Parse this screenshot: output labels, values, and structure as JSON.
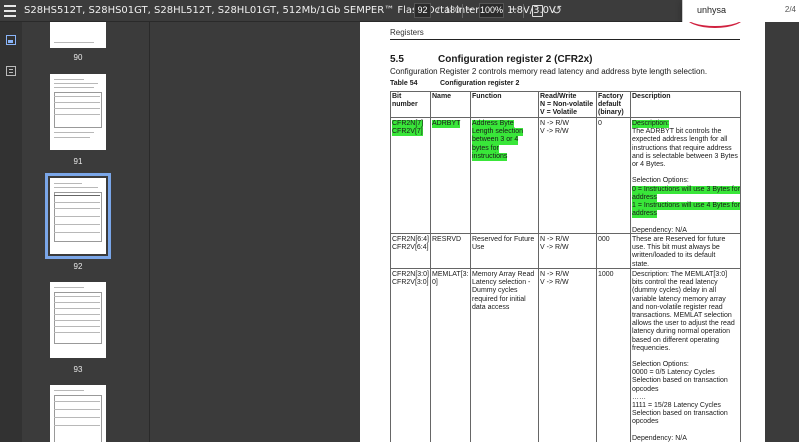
{
  "toolbar": {
    "title": "S28HS512T, S28HS01GT, S28HL512T, S28HL01GT, 512Mb/1Gb SEMPER™ Flash Octal interface, 1.8V/3.0V",
    "page_current": "92",
    "page_sep": "/",
    "page_total": "180",
    "zoom_out_symbol": "–",
    "zoom_value": "100%",
    "zoom_in_symbol": "+"
  },
  "search": {
    "value": "unhysa",
    "count": "2/4"
  },
  "sidebar": {
    "thumbnails": [
      {
        "label": "90"
      },
      {
        "label": "91"
      },
      {
        "label": "92",
        "selected": true
      },
      {
        "label": "93"
      }
    ]
  },
  "page": {
    "header": "Registers",
    "section_number": "5.5",
    "section_title": "Configuration register 2 (CFR2x)",
    "section_desc": "Configuration Register 2 controls memory read latency and address byte length selection.",
    "table_number": "Table 54",
    "table_title": "Configuration register 2",
    "columns": [
      [
        "Bit",
        "number"
      ],
      [
        "Name"
      ],
      [
        "Function"
      ],
      [
        "Read/Write",
        "N = Non-volatile",
        "V = Volatile"
      ],
      [
        "Factory",
        "default",
        "(binary)"
      ],
      [
        "Description"
      ]
    ],
    "rows": [
      {
        "bit": [
          "CFR2N[7]",
          "CFR2V[7]"
        ],
        "name": [
          "ADRBYT"
        ],
        "function": [
          "Address Byte",
          "Length selection",
          "between 3 or 4",
          "bytes for",
          "instructions"
        ],
        "rw": [
          "N -> R/W",
          "V -> R/W"
        ],
        "default": [
          "0"
        ],
        "description": [
          "Description:",
          "The ADRBYT bit controls the",
          "expected address length for all",
          "instructions that require address",
          "and is selectable between 3 Bytes",
          "or 4 Bytes.",
          "",
          "Selection Options:",
          "0 = Instructions will use 3 Bytes for",
          "address",
          "1 = Instructions will use 4 Bytes for",
          "address",
          "",
          "Dependency: N/A"
        ]
      },
      {
        "bit": [
          "CFR2N[6:4]",
          "CFR2V[6:4]"
        ],
        "name": [
          "RESRVD"
        ],
        "function": [
          "Reserved for Future",
          "Use"
        ],
        "rw": [
          "N -> R/W",
          "V -> R/W"
        ],
        "default": [
          "000"
        ],
        "description": [
          "These are Reserved for future",
          "use. This bit must always be",
          "written/loaded to its default",
          "state."
        ]
      },
      {
        "bit": [
          "CFR2N[3:0]",
          "CFR2V[3:0]"
        ],
        "name": [
          "MEMLAT[3:",
          "0]"
        ],
        "function": [
          "Memory Array Read",
          "Latency selection -",
          "Dummy cycles",
          "required for initial",
          "data access"
        ],
        "rw": [
          "N -> R/W",
          "V -> R/W"
        ],
        "default": [
          "1000"
        ],
        "description": [
          "Description: The MEMLAT[3:0]",
          "bits control the read latency",
          "(dummy cycles) delay in all",
          "variable latency memory array",
          "and non-volatile register read",
          "transactions. MEMLAT selection",
          "allows the user to adjust the read",
          "latency during normal operation",
          "based on different operating",
          "frequencies.",
          "",
          "Selection Options:",
          "0000 = 0/5 Latency Cycles",
          "Selection based on transaction",
          "opcodes",
          "……",
          "1111 = 15/28 Latency Cycles",
          "Selection based on transaction",
          "opcodes",
          "",
          "Dependency: N/A"
        ]
      }
    ]
  },
  "colors": {
    "highlight": "#39e639",
    "selection_outline": "#7aa6e8",
    "toolbar_bg": "#3c3c3c",
    "canvas_bg": "#3b3b3b"
  }
}
